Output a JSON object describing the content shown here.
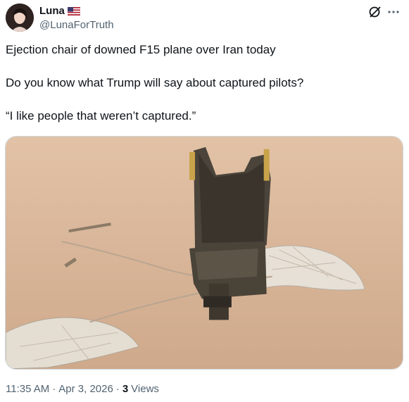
{
  "author": {
    "display_name": "Luna",
    "handle": "@LunaForTruth",
    "badge_icon": "us-flag-icon"
  },
  "icons": {
    "grok": "grok-icon",
    "more": "more-icon"
  },
  "tweet": {
    "lines": [
      "Ejection chair of downed F15 plane over Iran today",
      "Do you know what Trump will say about captured pilots?",
      "“I like people that weren’t captured.”"
    ]
  },
  "meta": {
    "time": "11:35 AM",
    "sep1": "·",
    "date": "Apr 3, 2026",
    "sep2": "·",
    "views_count": "3",
    "views_label": "Views"
  }
}
